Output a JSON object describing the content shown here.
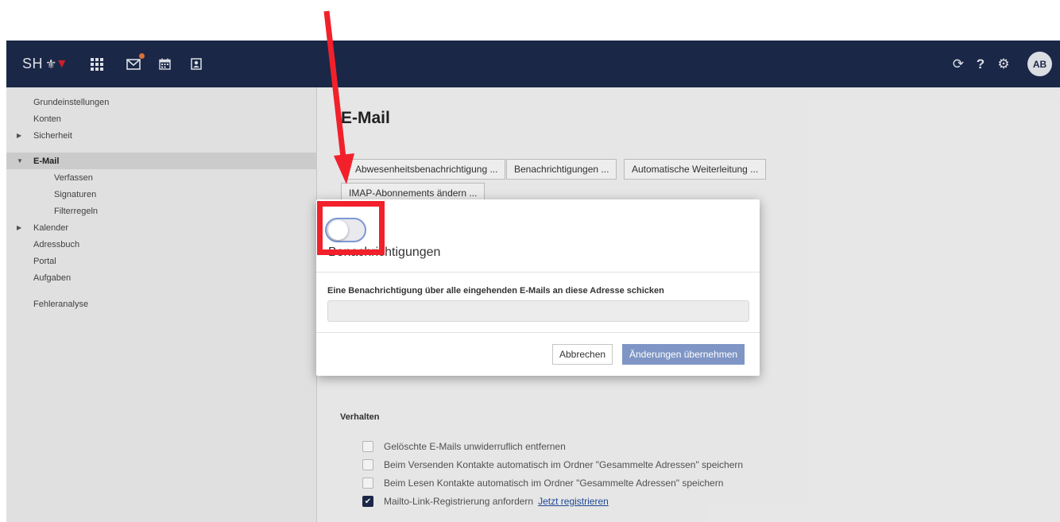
{
  "topbar": {
    "logo_text": "SH",
    "avatar_initials": "AB",
    "icons": [
      "apps-icon",
      "mail-icon",
      "calendar-icon",
      "contacts-icon",
      "sync-icon",
      "help-icon",
      "gear-icon"
    ]
  },
  "sidebar": {
    "items": [
      {
        "label": "Grundeinstellungen"
      },
      {
        "label": "Konten"
      },
      {
        "label": "Sicherheit"
      },
      {
        "label": "E-Mail"
      },
      {
        "label": "Verfassen"
      },
      {
        "label": "Signaturen"
      },
      {
        "label": "Filterregeln"
      },
      {
        "label": "Kalender"
      },
      {
        "label": "Adressbuch"
      },
      {
        "label": "Portal"
      },
      {
        "label": "Aufgaben"
      },
      {
        "label": "Fehleranalyse"
      }
    ]
  },
  "main": {
    "title": "E-Mail",
    "buttons": {
      "absence": "Abwesenheitsbenachrichtigung ...",
      "notifications": "Benachrichtigungen ...",
      "forwarding": "Automatische Weiterleitung ...",
      "imap": "IMAP-Abonnements ändern ..."
    },
    "section_label": "Verhalten",
    "options": [
      {
        "label": "Gelöschte E-Mails unwiderruflich entfernen",
        "checked": false
      },
      {
        "label": "Beim Versenden Kontakte automatisch im Ordner \"Gesammelte Adressen\" speichern",
        "checked": false
      },
      {
        "label": "Beim Lesen Kontakte automatisch im Ordner \"Gesammelte Adressen\" speichern",
        "checked": false
      },
      {
        "label": "Mailto-Link-Registrierung anfordern",
        "checked": true,
        "link": "Jetzt registrieren"
      }
    ]
  },
  "modal": {
    "title": "Benachrichtigungen",
    "toggle_on": false,
    "field_label": "Eine Benachrichtigung über alle eingehenden E-Mails an diese Adresse schicken",
    "field_value": "",
    "cancel_label": "Abbrechen",
    "apply_label": "Änderungen übernehmen"
  },
  "colors": {
    "topbar": "#1c2a4b",
    "primary_button": "#7f95c5",
    "annotation": "#f2202b"
  }
}
